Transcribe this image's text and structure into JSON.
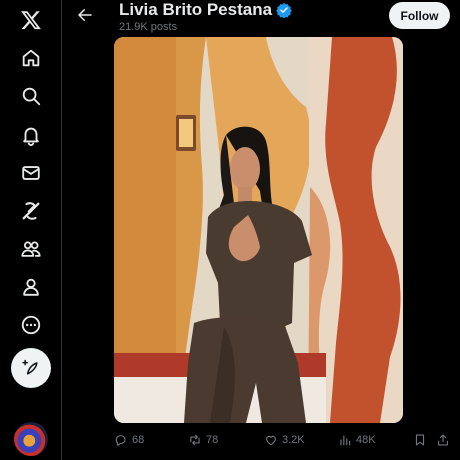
{
  "post": {
    "author_name": "Livia Brito Pestana",
    "posts_count": "21.9K posts",
    "follow_label": "Follow"
  },
  "actions": {
    "replies": "68",
    "reposts": "78",
    "likes": "3.2K",
    "views": "48K"
  },
  "icons": {
    "logo": "x-logo-icon",
    "home": "home-icon",
    "search": "search-icon",
    "notifications": "bell-icon",
    "messages": "mail-icon",
    "grok": "grok-icon",
    "communities": "people-icon",
    "profile": "person-icon",
    "more": "more-circle-icon",
    "compose": "compose-icon"
  },
  "colors": {
    "background": "#000000",
    "verified": "#1d9bf0",
    "muted_text": "#71767b",
    "follow_bg": "#eff3f4"
  }
}
